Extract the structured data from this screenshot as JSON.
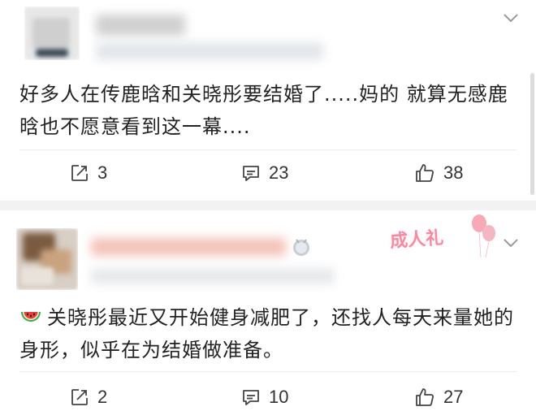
{
  "posts": [
    {
      "text": "好多人在传鹿晗和关晓彤要结婚了.....妈的 就算无感鹿晗也不愿意看到这一幕....",
      "actions": {
        "repost": "3",
        "comment": "23",
        "like": "38"
      }
    },
    {
      "badge": "成人礼",
      "text": "关晓彤最近又开始健身减肥了，还找人每天来量她的身形，似乎在为结婚做准备。",
      "actions": {
        "repost": "2",
        "comment": "10",
        "like": "27"
      }
    }
  ],
  "icons": {
    "repost": "share-icon",
    "comment": "comment-icon",
    "like": "thumbs-up-icon",
    "more": "chevron-down-icon",
    "emoji": "watermelon-icon"
  },
  "colors": {
    "text": "#222222",
    "icon": "#444444",
    "separator": "#f2f2f2",
    "badge": "#f58aa0"
  }
}
